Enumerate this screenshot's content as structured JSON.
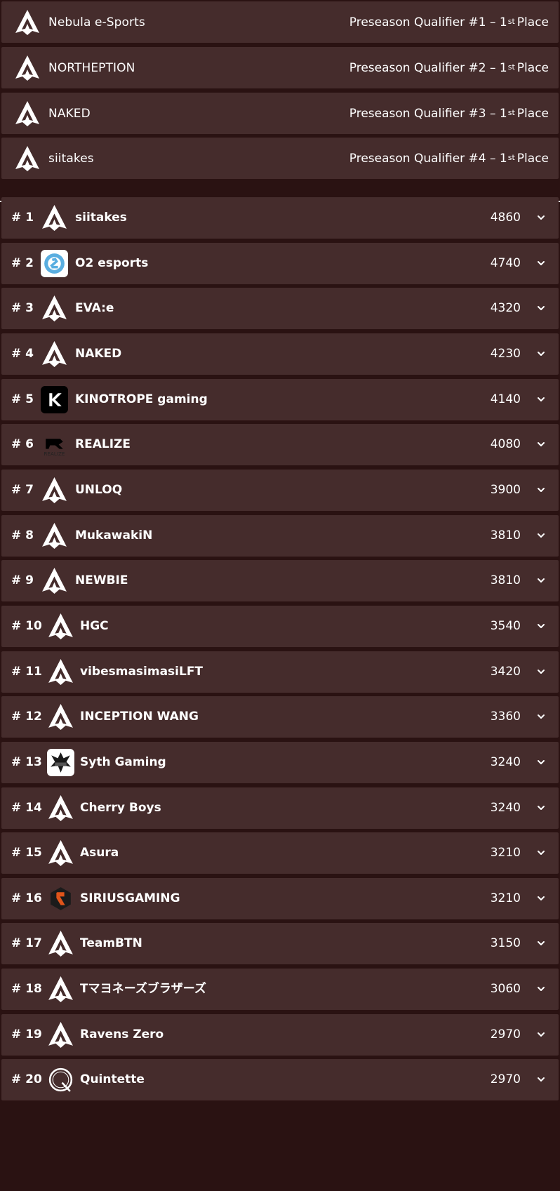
{
  "qualifiers": [
    {
      "team": "Nebula e-Sports",
      "achievement_prefix": "Preseason Qualifier #1 – 1",
      "achievement_sup": "st",
      "achievement_suffix": "Place"
    },
    {
      "team": "NORTHEPTION",
      "achievement_prefix": "Preseason Qualifier #2 – 1",
      "achievement_sup": "st",
      "achievement_suffix": "Place"
    },
    {
      "team": "NAKED",
      "achievement_prefix": "Preseason Qualifier #3 – 1",
      "achievement_sup": "st",
      "achievement_suffix": "Place"
    },
    {
      "team": "siitakes",
      "achievement_prefix": "Preseason Qualifier #4 – 1",
      "achievement_sup": "st",
      "achievement_suffix": "Place"
    }
  ],
  "rankings": [
    {
      "rank": "# 1",
      "team": "siitakes",
      "points": "4860",
      "logo": "apex-icon"
    },
    {
      "rank": "# 2",
      "team": "O2 esports",
      "points": "4740",
      "logo": "o2-esports-icon"
    },
    {
      "rank": "# 3",
      "team": "EVA:e",
      "points": "4320",
      "logo": "apex-icon"
    },
    {
      "rank": "# 4",
      "team": "NAKED",
      "points": "4230",
      "logo": "apex-icon"
    },
    {
      "rank": "# 5",
      "team": "KINOTROPE gaming",
      "points": "4140",
      "logo": "kinotrope-icon"
    },
    {
      "rank": "# 6",
      "team": "REALIZE",
      "points": "4080",
      "logo": "realize-icon",
      "logo_text": "REALIZE"
    },
    {
      "rank": "# 7",
      "team": "UNLOQ",
      "points": "3900",
      "logo": "apex-icon"
    },
    {
      "rank": "# 8",
      "team": "MukawakiN",
      "points": "3810",
      "logo": "apex-icon"
    },
    {
      "rank": "# 9",
      "team": "NEWBIE",
      "points": "3810",
      "logo": "apex-icon"
    },
    {
      "rank": "# 10",
      "team": "HGC",
      "points": "3540",
      "logo": "apex-icon"
    },
    {
      "rank": "# 11",
      "team": "vibesmasimasiLFT",
      "points": "3420",
      "logo": "apex-icon"
    },
    {
      "rank": "# 12",
      "team": "INCEPTION WANG",
      "points": "3360",
      "logo": "apex-icon"
    },
    {
      "rank": "# 13",
      "team": "Syth Gaming",
      "points": "3240",
      "logo": "syth-gaming-icon"
    },
    {
      "rank": "# 14",
      "team": "Cherry Boys",
      "points": "3240",
      "logo": "apex-icon"
    },
    {
      "rank": "# 15",
      "team": "Asura",
      "points": "3210",
      "logo": "apex-icon"
    },
    {
      "rank": "# 16",
      "team": "SIRIUSGAMING",
      "points": "3210",
      "logo": "siriusgaming-icon"
    },
    {
      "rank": "# 17",
      "team": "TeamBTN",
      "points": "3150",
      "logo": "apex-icon"
    },
    {
      "rank": "# 18",
      "team": "Tマヨネーズブラザーズ",
      "points": "3060",
      "logo": "apex-icon"
    },
    {
      "rank": "# 19",
      "team": "Ravens Zero",
      "points": "2970",
      "logo": "apex-icon"
    },
    {
      "rank": "# 20",
      "team": "Quintette",
      "points": "2970",
      "logo": "quintette-icon"
    }
  ],
  "colors": {
    "background": "#2a1212",
    "row": "#452c2c",
    "text": "#ffffff",
    "o2_blue": "#5aaee0",
    "sirius_orange": "#e0541a"
  }
}
